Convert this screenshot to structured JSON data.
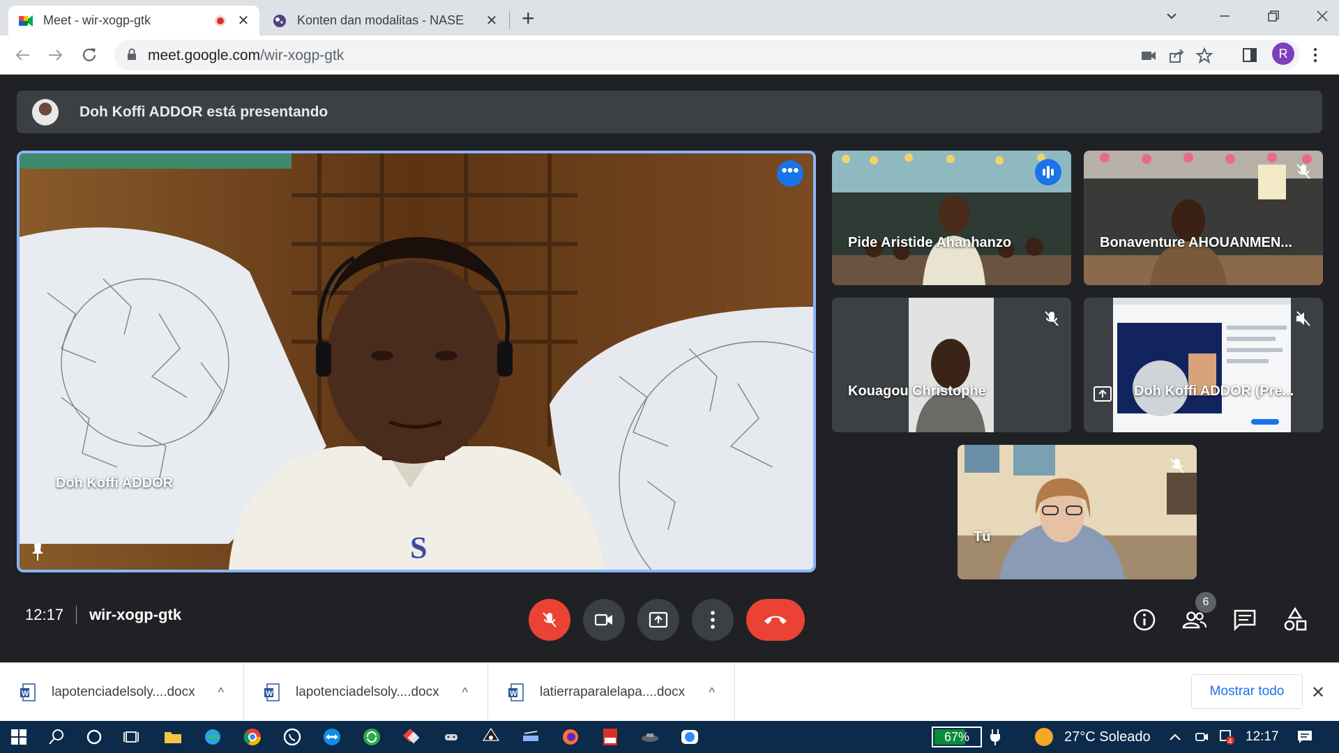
{
  "browser": {
    "tabs": [
      {
        "title": "Meet - wir-xogp-gtk",
        "active": true,
        "recording": true
      },
      {
        "title": "Konten dan modalitas - NASE",
        "active": false
      }
    ],
    "address": {
      "host": "meet.google.com",
      "path": "/wir-xogp-gtk"
    },
    "profile_initial": "R",
    "close_glyph": "✕",
    "new_tab_glyph": "+"
  },
  "meet": {
    "presenting_banner": "Doh Koffi ADDOR está presentando",
    "main_participant": "Doh Koffi ADDOR",
    "more_options_glyph": "•••",
    "participants": [
      {
        "name": "Pide Aristide Ahanhanzo",
        "state": "speaking"
      },
      {
        "name": "Bonaventure AHOUANMEN...",
        "state": "muted"
      },
      {
        "name": "Kouagou Christophe",
        "state": "muted"
      },
      {
        "name": "Doh Koffi ADDOR (Pre...",
        "state": "presentation"
      },
      {
        "name": "Tú",
        "state": "muted"
      }
    ],
    "time": "12:17",
    "meeting_code": "wir-xogp-gtk",
    "participant_count": "6"
  },
  "downloads": {
    "files": [
      "lapotenciadelsoly....docx",
      "lapotenciadelsoly....docx",
      "latierraparalelapa....docx"
    ],
    "show_all": "Mostrar todo",
    "close_glyph": "✕",
    "chevron_glyph": "^"
  },
  "taskbar": {
    "battery": "67%",
    "weather": "27°C  Soleado",
    "clock": "12:17",
    "notification_badge": "4"
  },
  "colors": {
    "meet_bg": "#202124",
    "accent_blue": "#1a73e8",
    "end_call_red": "#ea4335",
    "tile_border": "#8ab4f8"
  }
}
